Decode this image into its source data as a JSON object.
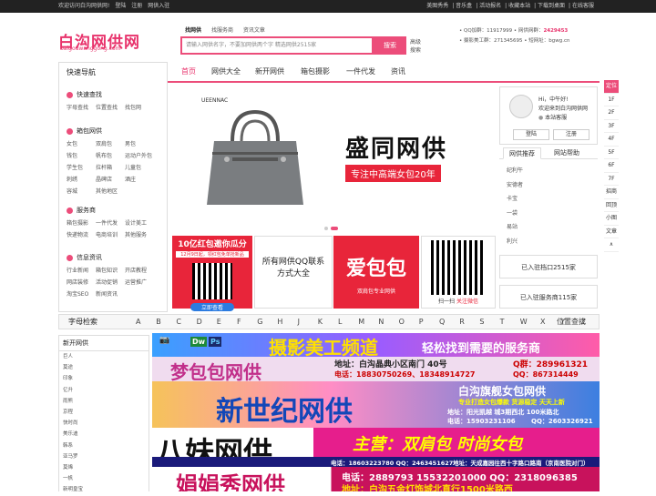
{
  "topbar": {
    "welcome": "欢迎访问白沟网供网!",
    "login": "登陆",
    "register": "注册",
    "join": "网供入驻",
    "right_links": [
      "美图秀秀",
      "音乐盒",
      "活动报名",
      "收藏本站",
      "下载到桌面",
      "在线客服"
    ]
  },
  "logo": {
    "title": "白沟网供网",
    "subtitle": "baigouwanggong.com"
  },
  "search": {
    "tabs": [
      "找网供",
      "找服务商",
      "资讯文章"
    ],
    "placeholder": "请输入网供名字，不要加网供两个字      精选网供2515家",
    "button": "搜索",
    "advanced": "高级搜索"
  },
  "contact": {
    "qq_label": "QQ加群：",
    "qq_value": "11917999",
    "hotline_label": "网供网群：",
    "hotline_value": "2429453",
    "photo_label": "摄影美工群：",
    "photo_value": "271345695",
    "web_label": "短网址：",
    "web_value": "bgwg.cn"
  },
  "nav": {
    "quick": "快速导航",
    "items": [
      "首页",
      "网供大全",
      "新开网供",
      "箱包摄影",
      "一件代发",
      "资讯"
    ]
  },
  "sidebar": [
    {
      "title": "快速查找",
      "links": [
        "字母查找",
        "位置查找",
        "找包网"
      ]
    },
    {
      "title": "箱包网供",
      "links": [
        "女包",
        "双肩包",
        "男包",
        "钱包",
        "帆布包",
        "运动户外包",
        "学生包",
        "拉杆箱",
        "儿童包",
        "刺绣",
        "晶碑店",
        "酒庄",
        "容城",
        "其他地区"
      ]
    },
    {
      "title": "服务商",
      "links": [
        "箱包摄影",
        "一件代发",
        "设计美工",
        "快递物流",
        "电商培训",
        "其他服务"
      ]
    },
    {
      "title": "信息资讯",
      "links": [
        "行业新闻",
        "箱包知识",
        "开店教程",
        "网店装修",
        "活动促销",
        "运营推广",
        "淘宝SEO",
        "新闻资讯"
      ]
    }
  ],
  "banner": {
    "brand": "UEENNAC",
    "title": "盛同网供",
    "subtitle": "专注中高端女包20年"
  },
  "promos": [
    {
      "title": "10亿红包邀你瓜分",
      "date": "12月9日起，领红包免单抢新品",
      "caption": "立即查看"
    },
    {
      "title": "所有网供QQ联系方式大全"
    },
    {
      "title": "爱包包",
      "caption": "双肩包专业网供"
    },
    {
      "caption_left": "扫一扫",
      "caption_right": "关注微信"
    }
  ],
  "user": {
    "greeting": "Hi，中午好!",
    "welcome": "欢迎来到白沟网供网",
    "service": "本站客服",
    "login": "登陆",
    "register": "注册"
  },
  "panel_tabs": [
    "网供推荐",
    "网站帮助"
  ],
  "recommend": [
    "纪利午",
    "安德者",
    "卡宝",
    "一袋",
    "易站",
    "利兴"
  ],
  "stats": {
    "shops": "已入驻档口2515家",
    "services": "已入驻服务商115家"
  },
  "right_nav": [
    "定位",
    "1F",
    "2F",
    "3F",
    "4F",
    "5F",
    "6F",
    "7F",
    "招商",
    "回顶",
    "小图",
    "文章",
    "∧"
  ],
  "letters": {
    "title": "字母检索",
    "list": [
      "A",
      "B",
      "C",
      "D",
      "E",
      "F",
      "G",
      "H",
      "J",
      "K",
      "L",
      "M",
      "N",
      "O",
      "P",
      "Q",
      "R",
      "S",
      "T",
      "W",
      "X",
      "Y",
      "Z"
    ],
    "search": "位置查找"
  },
  "newlist": {
    "title": "新开网供",
    "items": [
      "巨人",
      "莫途",
      "印象",
      "亿升",
      "雨熊",
      "京程",
      "快时尚",
      "美乐迪",
      "韩系",
      "亚马罗",
      "莫烯",
      "一帆",
      "新明皇宝"
    ]
  },
  "ads": [
    {
      "title": "摄影美工频道",
      "tagline": "轻松找到需要的服务商"
    },
    {
      "title": "梦包包网供",
      "addr": "地址：白沟晶典小区南门 40号",
      "qq": "Q群：289961321",
      "tel": "电话：18830750269、18348914727",
      "qq2": "QQ：867314449"
    },
    {
      "title": "新世纪网供",
      "brand": "白沟旗舰女包网供",
      "tag1": "专业打造女包爆款  货源稳定  天天上新",
      "addr": "地址：阳光凯越 城3期西北 100米路北",
      "tel": "电话：15903231106",
      "qq": "QQ：2603326921"
    },
    {
      "title": "八妹网供",
      "slogan": "主营：双肩包  时尚女包",
      "tel": "电话：18603223780 QQ：2463451627",
      "addr": "地址：天成嘉园往西十字路口路南（京南医院对门）"
    },
    {
      "title": "娟娟秀网供",
      "tel": "电话：2889793  15532201000  QQ：2318096385",
      "addr": "地址：白沟五金灯饰城北直行1500米路西"
    }
  ],
  "colors": {
    "accent": "#ec4d7a",
    "brand": "#e8336c",
    "red": "#e8253a"
  }
}
